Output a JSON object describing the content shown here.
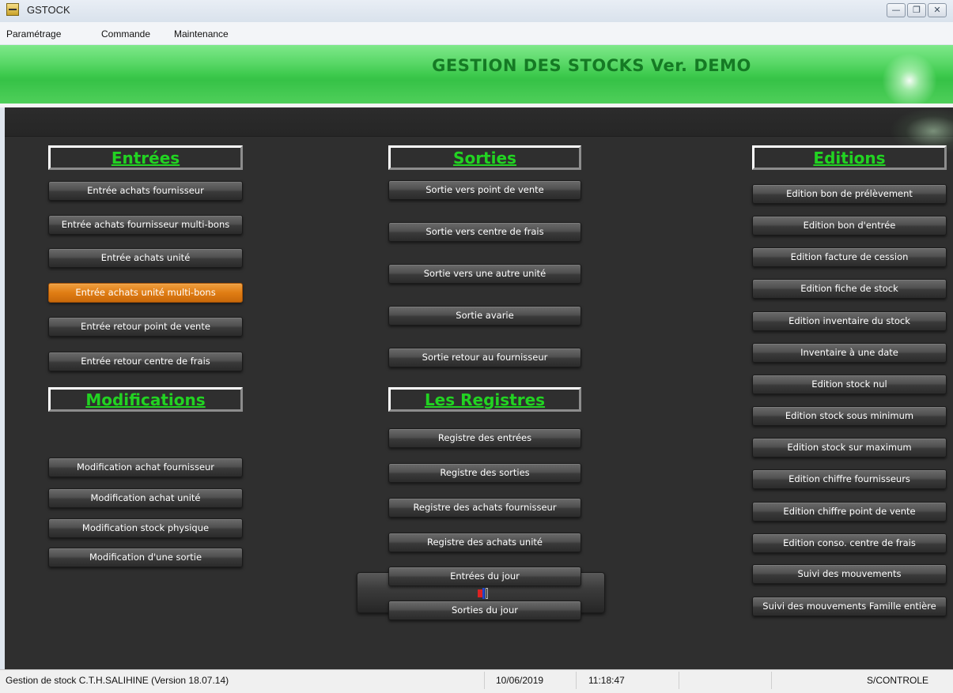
{
  "window": {
    "title": "GSTOCK"
  },
  "menu": [
    {
      "label": "Paramétrage"
    },
    {
      "label": "Commande"
    },
    {
      "label": "Maintenance"
    }
  ],
  "header": {
    "title": "GESTION  DES STOCKS  Ver. DEMO"
  },
  "sections": {
    "entrees": {
      "title": "Entrées",
      "buttons": [
        "Entrée achats fournisseur",
        "Entrée achats fournisseur multi-bons",
        "Entrée achats unité",
        "Entrée achats unité multi-bons",
        "Entrée retour point de vente",
        "Entrée retour centre de frais"
      ],
      "active_index": 3
    },
    "modifications": {
      "title": "Modifications",
      "buttons": [
        "Modification achat fournisseur",
        "Modification achat unité",
        "Modification stock physique",
        "Modification d'une sortie"
      ]
    },
    "sorties": {
      "title": "Sorties",
      "buttons": [
        "Sortie vers point de vente",
        "Sortie vers centre de frais",
        "Sortie vers une autre unité",
        "Sortie avarie",
        "Sortie retour au fournisseur"
      ]
    },
    "registres": {
      "title": "Les Registres",
      "buttons": [
        "Registre des entrées",
        "Registre des sorties",
        "Registre des achats fournisseur",
        "Registre des achats unité",
        "Entrées du jour",
        "Sorties du jour"
      ]
    },
    "editions": {
      "title": "Editions",
      "buttons": [
        "Edition bon de prélèvement",
        "Edition bon d'entrée",
        "Edition facture de cession",
        "Edition fiche de stock",
        "Edition inventaire du stock",
        "Inventaire à une date",
        "Edition stock nul",
        "Edition stock sous minimum",
        "Edition stock sur maximum",
        "Edition chiffre fournisseurs",
        "Edition chiffre point de vente",
        "Edition  conso. centre de frais",
        "Suivi des mouvements",
        "Suivi des mouvements Famille entière"
      ]
    }
  },
  "statusbar": {
    "app_info": "Gestion de stock C.T.H.SALIHINE (Version 18.07.14)",
    "date": "10/06/2019",
    "time": "11:18:47",
    "user": "S/CONTROLE"
  },
  "colors": {
    "header_green": "#3cc94c",
    "header_text": "#157a24",
    "section_title": "#22d322",
    "active_button": "#e07d14",
    "panel_bg": "#2f2f2f"
  },
  "icons": [
    "app-icon",
    "minimize-icon",
    "restore-icon",
    "close-icon",
    "toolbar-mini-icon"
  ]
}
